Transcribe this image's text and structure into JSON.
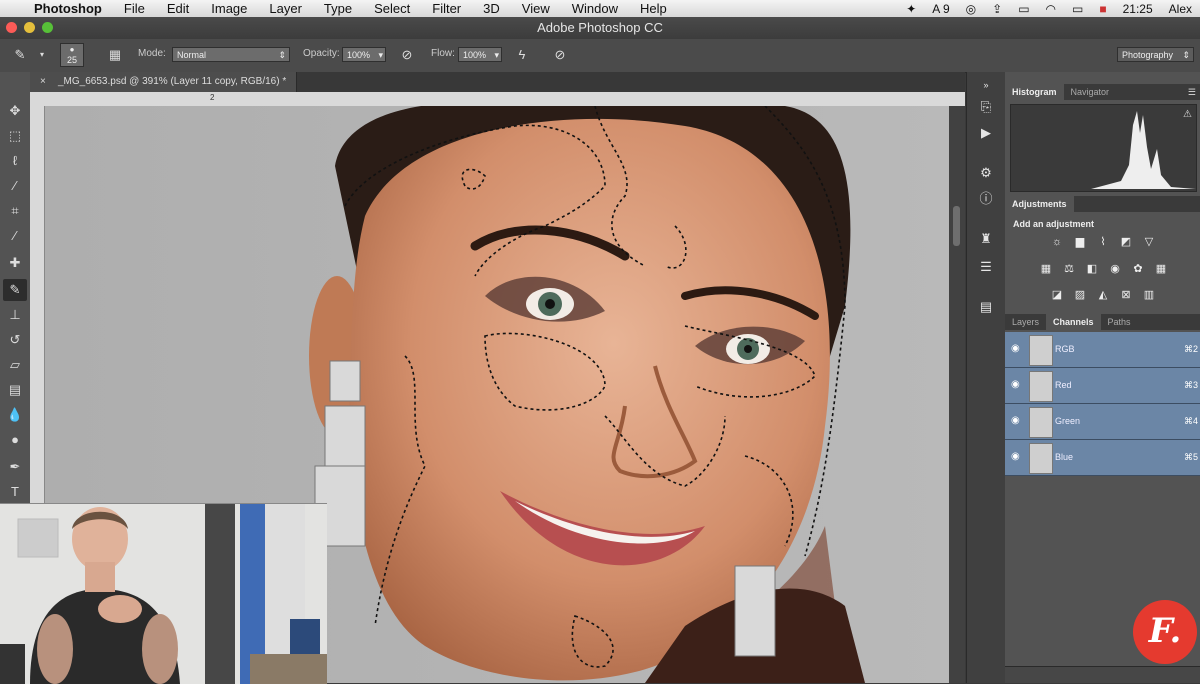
{
  "menubar": {
    "app": "Photoshop",
    "items": [
      "File",
      "Edit",
      "Image",
      "Layer",
      "Type",
      "Select",
      "Filter",
      "3D",
      "View",
      "Window",
      "Help"
    ],
    "status": {
      "adobe_count": "9",
      "time": "21:25",
      "user": "Alex"
    }
  },
  "window": {
    "title": "Adobe Photoshop CC"
  },
  "options": {
    "brush_size": "25",
    "mode_label": "Mode:",
    "mode_value": "Normal",
    "opacity_label": "Opacity:",
    "opacity_value": "100%",
    "flow_label": "Flow:",
    "flow_value": "100%",
    "workspace": "Photography"
  },
  "document": {
    "tab_title": "_MG_6653.psd @ 391% (Layer 11 copy, RGB/16) *",
    "ruler_mark": "2"
  },
  "panels": {
    "top_tabs": [
      "Histogram",
      "Navigator"
    ],
    "adjustments_tab": "Adjustments",
    "adjustments_title": "Add an adjustment",
    "bottom_tabs": [
      "Layers",
      "Channels",
      "Paths"
    ],
    "channels": [
      {
        "name": "RGB",
        "key": "⌘2"
      },
      {
        "name": "Red",
        "key": "⌘3"
      },
      {
        "name": "Green",
        "key": "⌘4"
      },
      {
        "name": "Blue",
        "key": "⌘5"
      }
    ]
  },
  "brand": {
    "logo_letter": "F."
  },
  "colors": {
    "selection_row": "#6b86a6",
    "logo": "#e53a2f",
    "panel": "#535353"
  }
}
